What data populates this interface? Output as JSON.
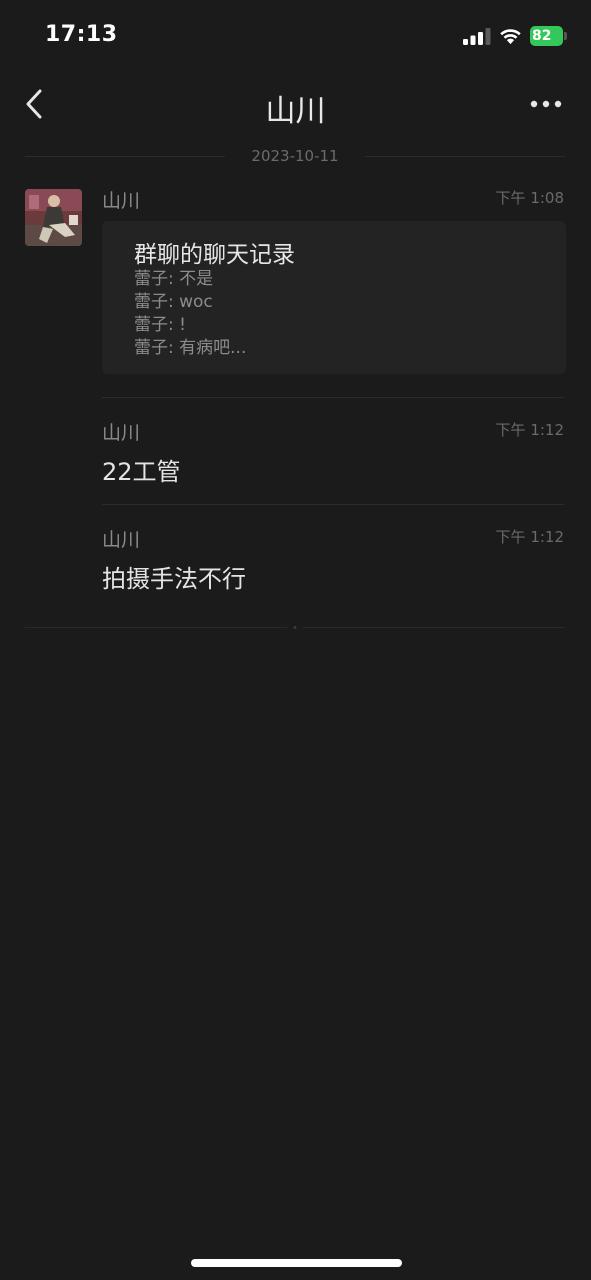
{
  "status_bar": {
    "time": "17:13",
    "battery_level": "82",
    "battery_color": "#34c759",
    "icons": [
      "signal-icon",
      "wifi-icon",
      "battery-icon"
    ]
  },
  "nav": {
    "title": "山川",
    "back_icon": "chevron-left-icon",
    "more_icon": "more-dots-icon"
  },
  "date_separator": "2023-10-11",
  "messages": [
    {
      "sender": "山川",
      "time": "下午 1:08",
      "type": "chat-record",
      "record": {
        "title": "群聊的聊天记录",
        "lines": [
          "蕾子: 不是",
          "蕾子: woc",
          "蕾子: !",
          "蕾子: 有病吧..."
        ]
      }
    },
    {
      "sender": "山川",
      "time": "下午 1:12",
      "type": "text",
      "text": "22工管"
    },
    {
      "sender": "山川",
      "time": "下午 1:12",
      "type": "text",
      "text": "拍摄手法不行"
    }
  ]
}
